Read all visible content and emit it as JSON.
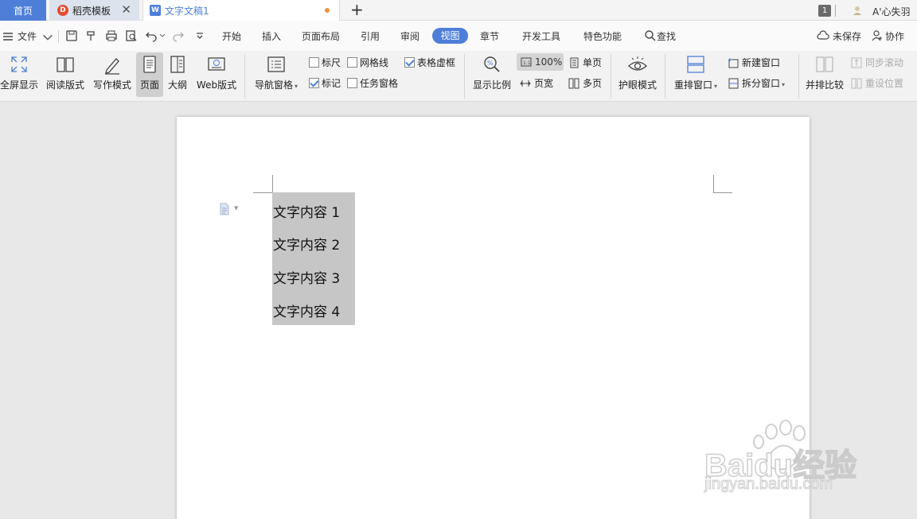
{
  "tabs": {
    "home": "首页",
    "template": "稻壳模板",
    "document": "文字文稿1",
    "add": "+",
    "close": "✕",
    "window_count": "1",
    "user_name": "A'心失羽"
  },
  "menu": {
    "file": "文件",
    "items": [
      "开始",
      "插入",
      "页面布局",
      "引用",
      "审阅",
      "视图",
      "章节",
      "开发工具",
      "特色功能"
    ],
    "search": "查找",
    "unsaved": "未保存",
    "collab": "协作"
  },
  "ribbon": {
    "fullscreen": "全屏显示",
    "reading": "阅读版式",
    "writing": "写作模式",
    "page_view": "页面",
    "outline": "大纲",
    "web_view": "Web版式",
    "nav_pane": "导航窗格",
    "ruler": "标尺",
    "gridlines": "网格线",
    "table_gridlines": "表格虚框",
    "marks": "标记",
    "task_pane": "任务窗格",
    "zoom_label": "显示比例",
    "zoom_value": "100%",
    "page_width": "页宽",
    "single_page": "单页",
    "multi_page": "多页",
    "eye_mode": "护眼模式",
    "rearrange": "重排窗口",
    "new_window": "新建窗口",
    "split_window": "拆分窗口",
    "side_by_side": "并排比较",
    "sync_scroll": "同步滚动",
    "reset_position": "重设位置",
    "checked": {
      "ruler": false,
      "gridlines": false,
      "table_gridlines": true,
      "marks": true,
      "task_pane": false
    }
  },
  "document": {
    "lines": [
      "文字内容 1",
      "文字内容 2",
      "文字内容 3",
      "文字内容 4"
    ]
  },
  "watermark": {
    "brand": "Baidu经验",
    "url": "jingyan.baidu.com"
  },
  "colors": {
    "accent": "#4d7fd8",
    "selection": "#c6c6c6",
    "unsaved_dot": "#f0913a"
  }
}
